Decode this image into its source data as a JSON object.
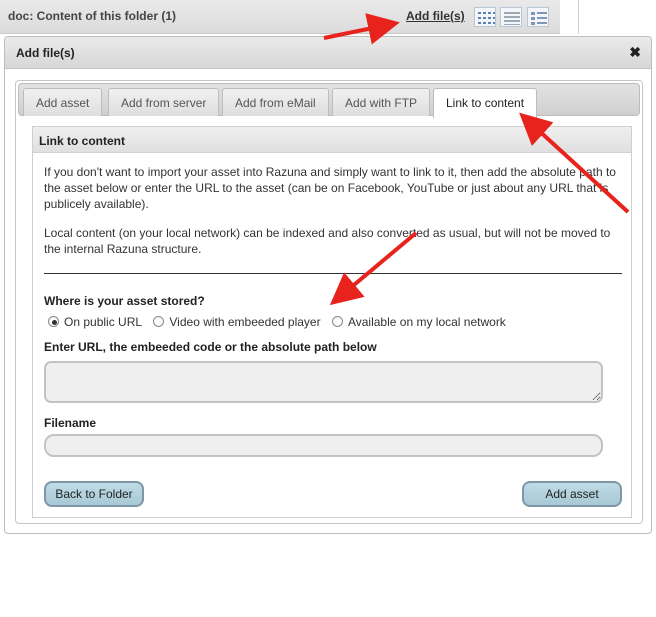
{
  "folder_bar": {
    "title": "doc: Content of this folder (1)",
    "add_files_link": "Add file(s)",
    "view_icons": [
      "grid-view-icon",
      "list-view-icon",
      "detail-view-icon"
    ]
  },
  "dialog": {
    "title": "Add file(s)",
    "close_icon": "close-icon"
  },
  "tabs": [
    {
      "label": "Add asset"
    },
    {
      "label": "Add from server"
    },
    {
      "label": "Add from eMail"
    },
    {
      "label": "Add with FTP"
    },
    {
      "label": "Link to content",
      "active": true
    }
  ],
  "panel": {
    "title": "Link to content",
    "paragraph1": "If you don't want to import your asset into Razuna and simply want to link to it, then add the absolute path to the asset below or enter the URL to the asset (can be on Facebook, YouTube or just about any URL that is publicely available).",
    "paragraph2": "Local content (on your local network) can be indexed and also converted as usual, but will not be moved to the internal Razuna structure.",
    "question": "Where is your asset stored?",
    "radio_options": [
      {
        "label": "On public URL",
        "checked": true
      },
      {
        "label": "Video with embeeded player",
        "checked": false
      },
      {
        "label": "Available on my local network",
        "checked": false
      }
    ],
    "url_label": "Enter URL, the embeeded code or the absolute path below",
    "url_value": "",
    "filename_label": "Filename",
    "filename_value": "",
    "back_button": "Back to Folder",
    "add_button": "Add asset"
  },
  "colors": {
    "annotation_arrow": "#e8231d",
    "button_fill": "#b5d3df"
  }
}
